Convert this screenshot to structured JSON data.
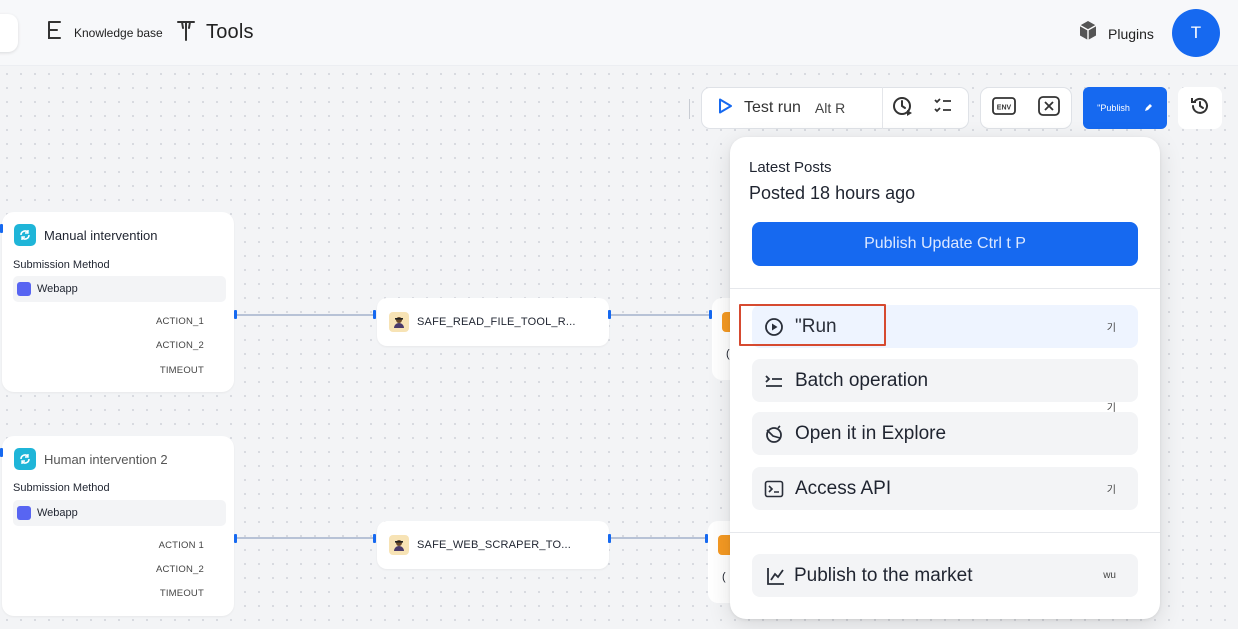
{
  "header": {
    "knowledge_base_label": "Knowledge base",
    "tools_label": "Tools",
    "plugins_label": "Plugins",
    "avatar_initial": "T"
  },
  "toolbar": {
    "test_run_label": "Test run",
    "test_run_shortcut": "Alt R",
    "env_label": "ENV",
    "publish_label": "\"Publish"
  },
  "nodes": [
    {
      "title": "Manual intervention",
      "submission_label": "Submission Method",
      "method": "Webapp",
      "actions": [
        "ACTION_1",
        "ACTION_2",
        "TIMEOUT"
      ]
    },
    {
      "title": "Human intervention 2",
      "submission_label": "Submission Method",
      "method": "Webapp",
      "actions": [
        "ACTION 1",
        "ACTION_2",
        "TIMEOUT"
      ]
    }
  ],
  "tools": [
    {
      "label": "SAFE_READ_FILE_TOOL_R..."
    },
    {
      "label": "SAFE_WEB_SCRAPER_TO..."
    }
  ],
  "partial_nodes": [
    {
      "text": "("
    },
    {
      "text": "("
    }
  ],
  "popup": {
    "title": "Latest Posts",
    "posted": "Posted 18 hours ago",
    "update_button": "Publish Update Ctrl t P",
    "items": [
      {
        "label": "\"Run",
        "shortcut": "기",
        "icon": "play-circle-icon"
      },
      {
        "label": "Batch operation",
        "shortcut": "기",
        "icon": "batch-list-icon"
      },
      {
        "label": "Open it in Explore",
        "shortcut": "",
        "icon": "explore-icon"
      },
      {
        "label": "Access API",
        "shortcut": "기",
        "icon": "terminal-icon"
      },
      {
        "label": "Publish to the market",
        "shortcut": "wu",
        "icon": "market-chart-icon"
      }
    ]
  },
  "colors": {
    "accent": "#1669f0",
    "highlight": "#d64a30",
    "node_badge": "#1fb5d8",
    "tool_badge": "#f7e3b5"
  }
}
